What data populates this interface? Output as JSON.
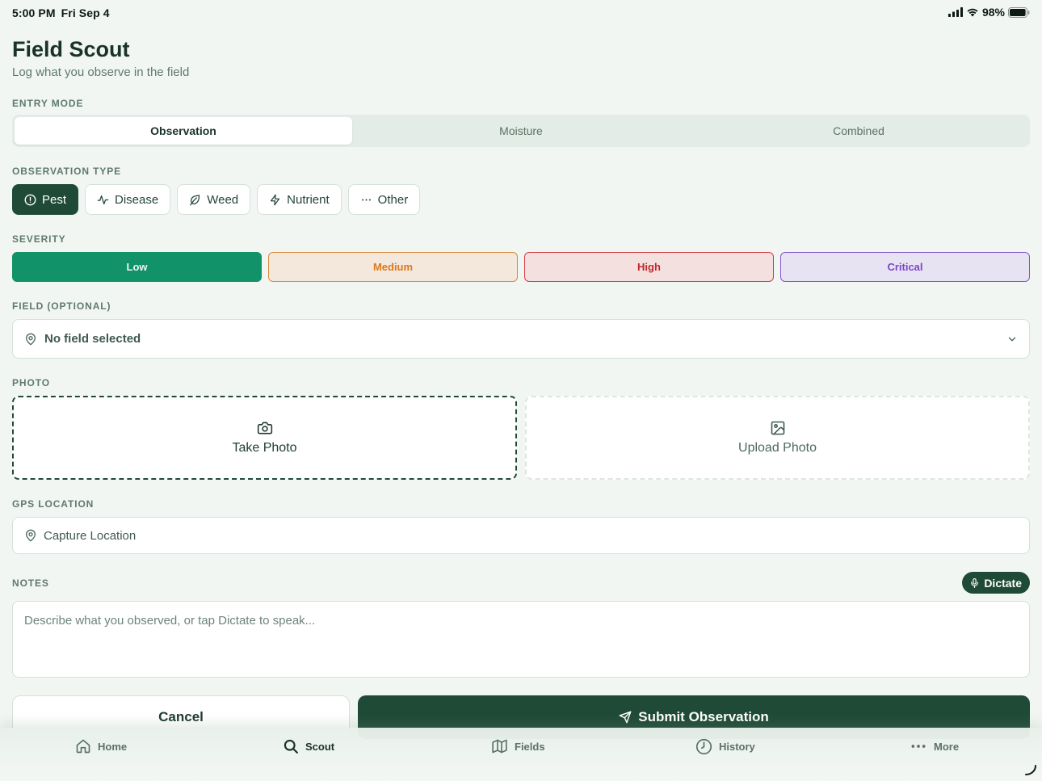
{
  "status_bar": {
    "time": "5:00 PM",
    "date": "Fri Sep 4",
    "battery": "98%"
  },
  "header": {
    "title": "Field Scout",
    "subtitle": "Log what you observe in the field"
  },
  "entry_mode": {
    "label": "ENTRY MODE",
    "options": [
      "Observation",
      "Moisture",
      "Combined"
    ],
    "selected": "Observation"
  },
  "observation_type": {
    "label": "OBSERVATION TYPE",
    "options": [
      {
        "label": "Pest",
        "icon": "alert-circle-icon"
      },
      {
        "label": "Disease",
        "icon": "activity-icon"
      },
      {
        "label": "Weed",
        "icon": "leaf-icon"
      },
      {
        "label": "Nutrient",
        "icon": "zap-icon"
      },
      {
        "label": "Other",
        "icon": "more-horizontal-icon"
      }
    ],
    "selected": "Pest"
  },
  "severity": {
    "label": "SEVERITY",
    "options": [
      "Low",
      "Medium",
      "High",
      "Critical"
    ],
    "selected": "Low",
    "colors": {
      "low": "#129269",
      "medium": "#d97a1f",
      "high": "#c4262b",
      "critical": "#7a46c6"
    }
  },
  "field": {
    "label": "FIELD (OPTIONAL)",
    "value": "No field selected"
  },
  "photo": {
    "label": "PHOTO",
    "take": "Take Photo",
    "upload": "Upload Photo"
  },
  "gps": {
    "label": "GPS LOCATION",
    "value": "Capture Location"
  },
  "notes": {
    "label": "NOTES",
    "dictate": "Dictate",
    "placeholder": "Describe what you observed, or tap Dictate to speak..."
  },
  "actions": {
    "cancel": "Cancel",
    "submit": "Submit Observation"
  },
  "tabs": [
    {
      "label": "Home",
      "icon": "home-icon"
    },
    {
      "label": "Scout",
      "icon": "search-icon"
    },
    {
      "label": "Fields",
      "icon": "map-icon"
    },
    {
      "label": "History",
      "icon": "clock-icon"
    },
    {
      "label": "More",
      "icon": "more-horizontal-icon"
    }
  ],
  "active_tab": "Scout",
  "brand_color": "#1f4a37"
}
